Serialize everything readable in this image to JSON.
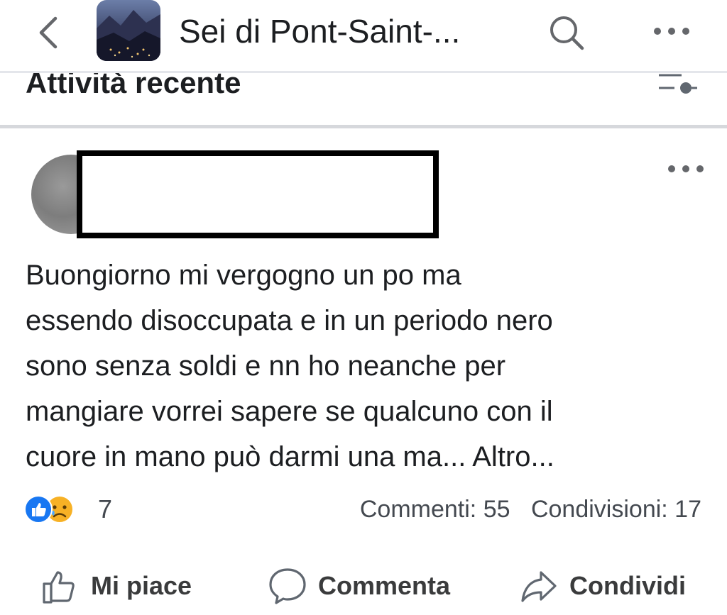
{
  "header": {
    "group_title": "Sei di Pont-Saint-...",
    "icons": {
      "back": "chevron-left-icon",
      "search": "search-icon",
      "more": "more-horizontal-icon"
    }
  },
  "section": {
    "title": "Attività recente",
    "filter_icon": "filter-sliders-icon"
  },
  "post": {
    "text": "Buongiorno mi vergogno  un po ma\nessendo disoccupata  e in un periodo  nero\nsono senza soldi e nn ho neanche  per\nmangiare  vorrei sapere se qualcuno  con il\ncuore in mano può darmi  una ma...",
    "more_link": " Altro...",
    "reactions": {
      "types": [
        "like",
        "sad"
      ],
      "count": "7"
    },
    "comments": "Commenti: 55",
    "shares": "Condivisioni: 17"
  },
  "actions": {
    "like": "Mi piace",
    "comment": "Commenta",
    "share": "Condividi"
  },
  "colors": {
    "like_blue": "#1877f2",
    "sad_yellow": "#f7b125",
    "text": "#1c1e21",
    "secondary": "#444950"
  }
}
